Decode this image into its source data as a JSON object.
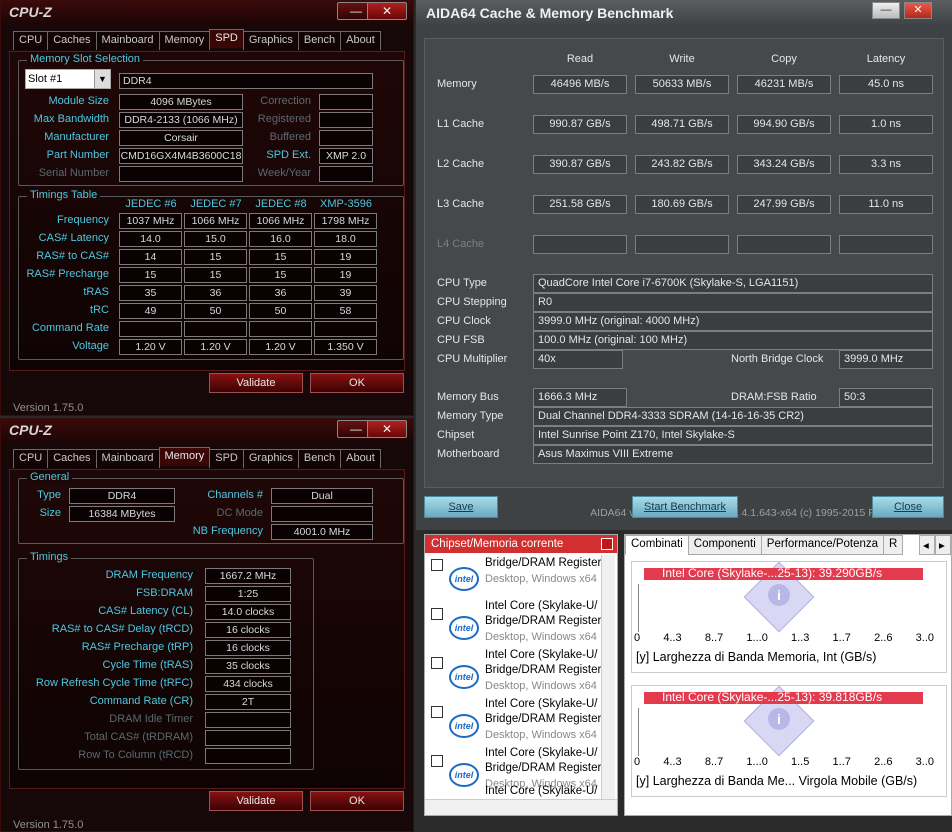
{
  "cpuz_top": {
    "title": "CPU-Z",
    "min": "—",
    "close": "✕",
    "tabs": [
      "CPU",
      "Caches",
      "Mainboard",
      "Memory",
      "SPD",
      "Graphics",
      "Bench",
      "About"
    ],
    "active_tab": "SPD",
    "slot_group": "Memory Slot Selection",
    "slot": "Slot #1",
    "slot_type": "DDR4",
    "rows_left": [
      {
        "label": "Module Size",
        "value": "4096 MBytes"
      },
      {
        "label": "Max Bandwidth",
        "value": "DDR4-2133 (1066 MHz)"
      },
      {
        "label": "Manufacturer",
        "value": "Corsair"
      },
      {
        "label": "Part Number",
        "value": "CMD16GX4M4B3600C18"
      },
      {
        "label": "Serial Number",
        "value": ""
      }
    ],
    "rows_right": [
      {
        "label": "Correction",
        "value": ""
      },
      {
        "label": "Registered",
        "value": ""
      },
      {
        "label": "Buffered",
        "value": ""
      },
      {
        "label": "SPD Ext.",
        "value": "XMP 2.0"
      },
      {
        "label": "Week/Year",
        "value": ""
      }
    ],
    "timings_group": "Timings Table",
    "timing_cols": [
      "JEDEC #6",
      "JEDEC #7",
      "JEDEC #8",
      "XMP-3596"
    ],
    "timing_rows": [
      {
        "label": "Frequency",
        "values": [
          "1037 MHz",
          "1066 MHz",
          "1066 MHz",
          "1798 MHz"
        ]
      },
      {
        "label": "CAS# Latency",
        "values": [
          "14.0",
          "15.0",
          "16.0",
          "18.0"
        ]
      },
      {
        "label": "RAS# to CAS#",
        "values": [
          "14",
          "15",
          "15",
          "19"
        ]
      },
      {
        "label": "RAS# Precharge",
        "values": [
          "15",
          "15",
          "15",
          "19"
        ]
      },
      {
        "label": "tRAS",
        "values": [
          "35",
          "36",
          "36",
          "39"
        ]
      },
      {
        "label": "tRC",
        "values": [
          "49",
          "50",
          "50",
          "58"
        ]
      },
      {
        "label": "Command Rate",
        "values": [
          "",
          "",
          "",
          ""
        ]
      },
      {
        "label": "Voltage",
        "values": [
          "1.20 V",
          "1.20 V",
          "1.20 V",
          "1.350 V"
        ]
      }
    ],
    "validate": "Validate",
    "ok": "OK",
    "version": "Version 1.75.0"
  },
  "cpuz_bot": {
    "title": "CPU-Z",
    "min": "—",
    "close": "✕",
    "tabs": [
      "CPU",
      "Caches",
      "Mainboard",
      "Memory",
      "SPD",
      "Graphics",
      "Bench",
      "About"
    ],
    "active_tab": "Memory",
    "general_group": "General",
    "type_label": "Type",
    "type": "DDR4",
    "size_label": "Size",
    "size": "16384 MBytes",
    "channels_label": "Channels #",
    "channels": "Dual",
    "dcmode_label": "DC Mode",
    "dcmode": "",
    "nbfreq_label": "NB Frequency",
    "nbfreq": "4001.0 MHz",
    "timings_group": "Timings",
    "timings": [
      {
        "label": "DRAM Frequency",
        "value": "1667.2 MHz"
      },
      {
        "label": "FSB:DRAM",
        "value": "1:25"
      },
      {
        "label": "CAS# Latency (CL)",
        "value": "14.0 clocks"
      },
      {
        "label": "RAS# to CAS# Delay (tRCD)",
        "value": "16 clocks"
      },
      {
        "label": "RAS# Precharge (tRP)",
        "value": "16 clocks"
      },
      {
        "label": "Cycle Time (tRAS)",
        "value": "35 clocks"
      },
      {
        "label": "Row Refresh Cycle Time (tRFC)",
        "value": "434 clocks"
      },
      {
        "label": "Command Rate (CR)",
        "value": "2T"
      },
      {
        "label": "DRAM Idle Timer",
        "value": ""
      },
      {
        "label": "Total CAS# (tRDRAM)",
        "value": ""
      },
      {
        "label": "Row To Column (tRCD)",
        "value": ""
      }
    ],
    "validate": "Validate",
    "ok": "OK",
    "version": "Version 1.75.0"
  },
  "aida": {
    "title": "AIDA64 Cache & Memory Benchmark",
    "min": "—",
    "close": "✕",
    "cols": [
      "Read",
      "Write",
      "Copy",
      "Latency"
    ],
    "rows": [
      {
        "label": "Memory",
        "values": [
          "46496 MB/s",
          "50633 MB/s",
          "46231 MB/s",
          "45.0 ns"
        ]
      },
      {
        "label": "L1 Cache",
        "values": [
          "990.87 GB/s",
          "498.71 GB/s",
          "994.90 GB/s",
          "1.0 ns"
        ]
      },
      {
        "label": "L2 Cache",
        "values": [
          "390.87 GB/s",
          "243.82 GB/s",
          "343.24 GB/s",
          "3.3 ns"
        ]
      },
      {
        "label": "L3 Cache",
        "values": [
          "251.58 GB/s",
          "180.69 GB/s",
          "247.99 GB/s",
          "11.0 ns"
        ]
      },
      {
        "label": "L4 Cache",
        "values": [
          "",
          "",
          "",
          ""
        ]
      }
    ],
    "info": [
      {
        "label": "CPU Type",
        "value": "QuadCore Intel Core i7-6700K  (Skylake-S, LGA1151)"
      },
      {
        "label": "CPU Stepping",
        "value": "R0"
      },
      {
        "label": "CPU Clock",
        "value": "3999.0 MHz  (original: 4000 MHz)"
      },
      {
        "label": "CPU FSB",
        "value": "100.0 MHz  (original: 100 MHz)"
      }
    ],
    "multiplier_label": "CPU Multiplier",
    "multiplier": "40x",
    "nbclock_label": "North Bridge Clock",
    "nbclock": "3999.0 MHz",
    "membus_label": "Memory Bus",
    "membus": "1666.3 MHz",
    "ratio_label": "DRAM:FSB Ratio",
    "ratio": "50:3",
    "info2": [
      {
        "label": "Memory Type",
        "value": "Dual Channel DDR4-3333 SDRAM  (14-16-16-35 CR2)"
      },
      {
        "label": "Chipset",
        "value": "Intel Sunrise Point Z170, Intel Skylake-S"
      },
      {
        "label": "Motherboard",
        "value": "Asus Maximus VIII Extreme"
      }
    ],
    "footer": "AIDA64 v5.60.3700 / BenchDLL 4.1.643-x64  (c) 1995-2015 FinalWire Ltd.",
    "save": "Save",
    "start": "Start Benchmark",
    "close_btn": "Close"
  },
  "list_panel": {
    "header": "Chipset/Memoria corrente",
    "items": [
      {
        "l1": "Bridge/DRAM Register",
        "l2": "Desktop, Windows x64"
      },
      {
        "l1": "Intel Core (Skylake-U/",
        "l2": "Bridge/DRAM Register",
        "l3": "Desktop, Windows x64"
      },
      {
        "l1": "Intel Core (Skylake-U/",
        "l2": "Bridge/DRAM Register",
        "l3": "Desktop, Windows x64"
      },
      {
        "l1": "Intel Core (Skylake-U/",
        "l2": "Bridge/DRAM Register",
        "l3": "Desktop, Windows x64"
      },
      {
        "l1": "Intel Core (Skylake-U/",
        "l2": "Bridge/DRAM Register",
        "l3": "Desktop, Windows x64"
      }
    ],
    "logo_text": "intel",
    "last_partial": "Intel Core (Skylake-U/"
  },
  "chart_panel": {
    "tabs": [
      "Combinati",
      "Componenti",
      "Performance/Potenza",
      "R"
    ],
    "active_tab": "Combinati",
    "charts": [
      {
        "bar_label": "Intel Core (Skylake-...25-13): 39.290GB/s",
        "ticks": [
          "0",
          "4..3",
          "8..7",
          "1...0",
          "1..3",
          "1..7",
          "2..6",
          "3..0"
        ],
        "y_tag": "[y]",
        "caption": "Larghezza di Banda Memoria, Int (GB/s)",
        "fill": 0.93
      },
      {
        "bar_label": "Intel Core (Skylake-...25-13): 39.818GB/s",
        "ticks": [
          "0",
          "4..3",
          "8..7",
          "1...0",
          "1..5",
          "1..7",
          "2..6",
          "3..0"
        ],
        "y_tag": "[y]",
        "caption": "Larghezza di Banda Me... Virgola Mobile (GB/s)",
        "fill": 0.93
      }
    ],
    "scroll_left": "◂",
    "scroll_right": "▸"
  }
}
